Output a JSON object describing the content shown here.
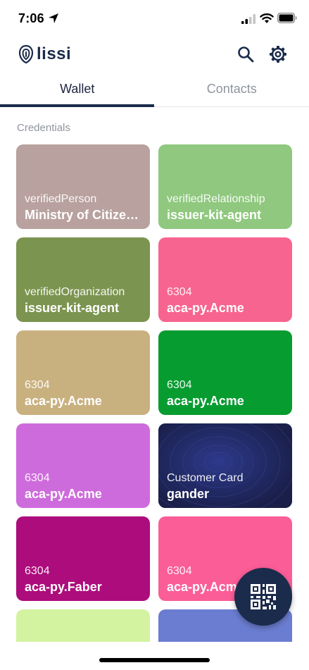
{
  "status_bar": {
    "time": "7:06"
  },
  "header": {
    "logo_text": "lissi",
    "icons": [
      "search-icon",
      "gear-icon"
    ]
  },
  "tabs": [
    {
      "label": "Wallet",
      "active": true
    },
    {
      "label": "Contacts",
      "active": false
    }
  ],
  "section_title": "Credentials",
  "credentials": [
    {
      "type": "verifiedPerson",
      "issuer": "Ministry of Citizenship",
      "color": "#b8a19e"
    },
    {
      "type": "verifiedRelationship",
      "issuer": "issuer-kit-agent",
      "color": "#8fc87e"
    },
    {
      "type": "verifiedOrganization",
      "issuer": "issuer-kit-agent",
      "color": "#7b944f"
    },
    {
      "type": "6304",
      "issuer": "aca-py.Acme",
      "color": "#f76490"
    },
    {
      "type": "6304",
      "issuer": "aca-py.Acme",
      "color": "#c9b17f"
    },
    {
      "type": "6304",
      "issuer": "aca-py.Acme",
      "color": "#079c30"
    },
    {
      "type": "6304",
      "issuer": "aca-py.Acme",
      "color": "#ce6bdc"
    },
    {
      "type": "Customer Card",
      "issuer": "gander",
      "color": "#1d2455"
    },
    {
      "type": "6304",
      "issuer": "aca-py.Faber",
      "color": "#ad0c7c"
    },
    {
      "type": "6304",
      "issuer": "aca-py.Acme",
      "color": "#fb5d97"
    },
    {
      "type": "",
      "issuer": "",
      "color": "#d3f3a0"
    },
    {
      "type": "",
      "issuer": "",
      "color": "#6b7dd1"
    }
  ],
  "fab": {
    "icon": "qr-code-icon"
  }
}
